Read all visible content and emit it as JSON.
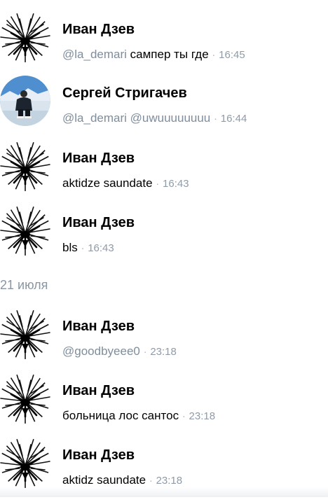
{
  "feed": {
    "items": [
      {
        "name": "Иван Дзев",
        "mention": "@la_demari",
        "text": "сампер ты где",
        "sep": "·",
        "time": "16:45",
        "avatar": "fur-pattern-avatar"
      },
      {
        "name": "Сергей Стригачев",
        "mention": "@la_demari",
        "text": "@uwuuuuuuuu",
        "sep": "·",
        "time": "16:44",
        "avatar": "photo-avatar"
      },
      {
        "name": "Иван Дзев",
        "mention": "",
        "text": "aktidze saundate",
        "sep": "·",
        "time": "16:43",
        "avatar": "fur-pattern-avatar"
      },
      {
        "name": "Иван Дзев",
        "mention": "",
        "text": "bls",
        "sep": "·",
        "time": "16:43",
        "avatar": "fur-pattern-avatar"
      }
    ],
    "date_header": "21 июля",
    "items_after": [
      {
        "name": "Иван Дзев",
        "mention": "@goodbyeee0",
        "text": "",
        "sep": "·",
        "time": "23:18",
        "avatar": "fur-pattern-avatar"
      },
      {
        "name": "Иван Дзев",
        "mention": "",
        "text": "больница лос сантос",
        "sep": "·",
        "time": "23:18",
        "avatar": "fur-pattern-avatar"
      },
      {
        "name": "Иван Дзев",
        "mention": "",
        "text": "aktidz saundate",
        "sep": "·",
        "time": "23:18",
        "avatar": "fur-pattern-avatar"
      }
    ]
  },
  "colors": {
    "mention": "#7f8d9c",
    "time": "#8f9ba8",
    "date_header": "#8a96a3",
    "name": "#000000"
  }
}
